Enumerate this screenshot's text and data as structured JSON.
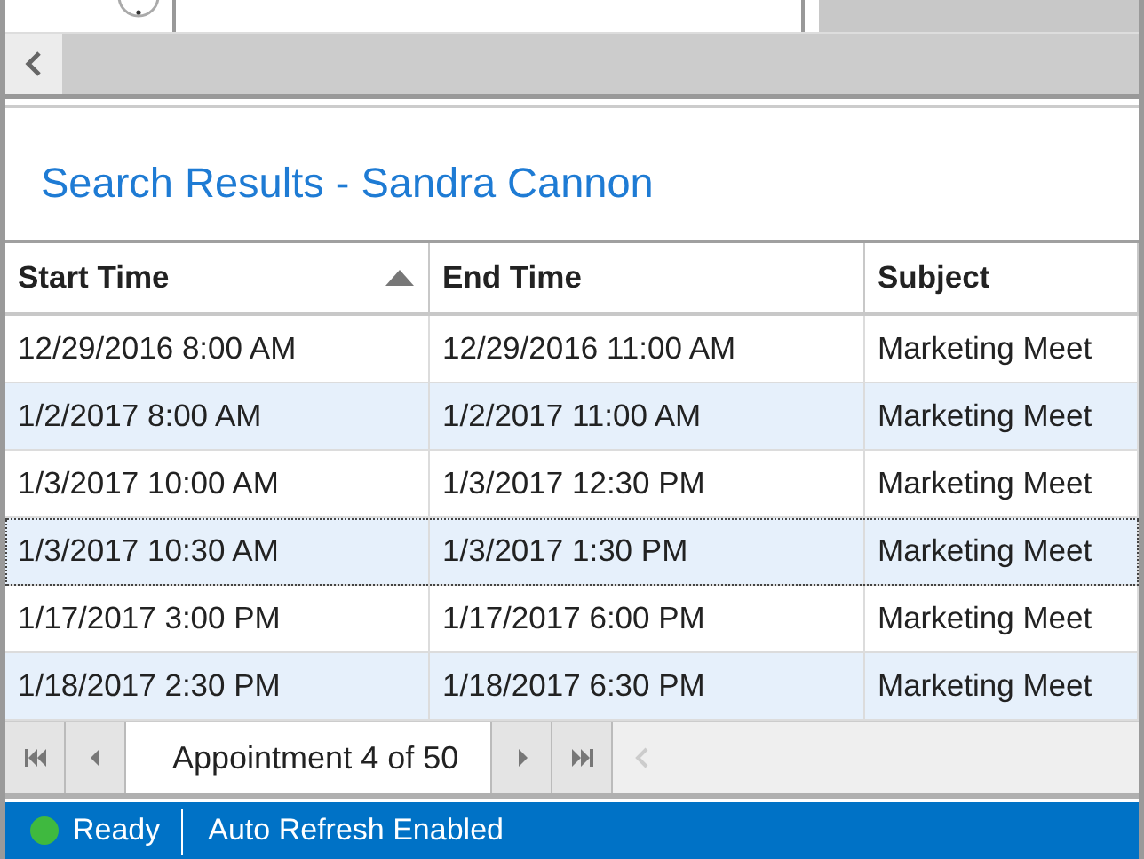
{
  "title": "Search Results - Sandra Cannon",
  "table": {
    "columns": [
      {
        "label": "Start Time",
        "sorted": true
      },
      {
        "label": "End Time",
        "sorted": false
      },
      {
        "label": "Subject",
        "sorted": false
      }
    ],
    "rows": [
      {
        "cells": [
          "12/29/2016 8:00 AM",
          "12/29/2016 11:00 AM",
          "Marketing Meet"
        ],
        "selected": false
      },
      {
        "cells": [
          "1/2/2017 8:00 AM",
          "1/2/2017 11:00 AM",
          "Marketing Meet"
        ],
        "selected": false
      },
      {
        "cells": [
          "1/3/2017 10:00 AM",
          "1/3/2017 12:30 PM",
          "Marketing Meet"
        ],
        "selected": false
      },
      {
        "cells": [
          "1/3/2017 10:30 AM",
          "1/3/2017 1:30 PM",
          "Marketing Meet"
        ],
        "selected": true
      },
      {
        "cells": [
          "1/17/2017 3:00 PM",
          "1/17/2017 6:00 PM",
          "Marketing Meet"
        ],
        "selected": false
      },
      {
        "cells": [
          "1/18/2017 2:30 PM",
          "1/18/2017 6:30 PM",
          "Marketing Meet"
        ],
        "selected": false
      }
    ]
  },
  "pager": {
    "label": "Appointment 4 of 50"
  },
  "status_bar": {
    "items": [
      "Ready",
      "Auto Refresh Enabled"
    ]
  }
}
